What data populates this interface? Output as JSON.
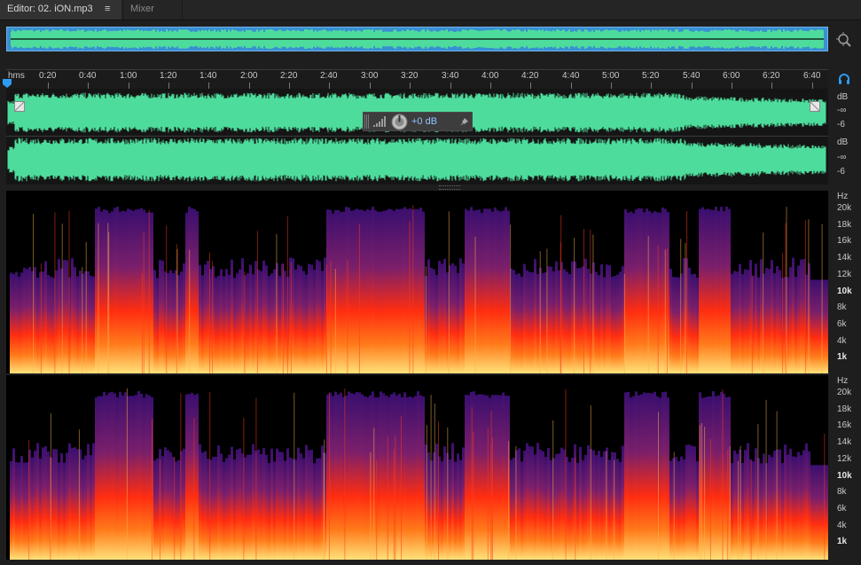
{
  "tabs": [
    {
      "label": "Editor: 02. iON.mp3",
      "active": true
    },
    {
      "label": "Mixer",
      "active": false
    }
  ],
  "icons": {
    "tab_menu": "hamburger-icon",
    "zoom": "zoom-navigator-icon",
    "monitor": "headphones-icon",
    "hud_meter": "level-meter-icon",
    "hud_knob": "volume-knob-icon",
    "hud_pin": "pin-icon"
  },
  "ruler": {
    "unit": "hms",
    "labels": [
      "0:20",
      "0:40",
      "1:00",
      "1:20",
      "1:40",
      "2:00",
      "2:20",
      "2:40",
      "3:00",
      "3:20",
      "3:40",
      "4:00",
      "4:20",
      "4:40",
      "5:00",
      "5:20",
      "5:40",
      "6:00",
      "6:20",
      "6:40"
    ]
  },
  "waveform": {
    "channels": [
      {
        "scale": [
          "dB",
          "-∞",
          "-6"
        ]
      },
      {
        "scale": [
          "dB",
          "-∞",
          "-6"
        ]
      }
    ]
  },
  "hud": {
    "value": "+0 dB"
  },
  "spectral": {
    "channels": [
      {
        "scale": [
          "Hz",
          "20k",
          "18k",
          "16k",
          "14k",
          "12k",
          "10k",
          "8k",
          "6k",
          "4k",
          "1k"
        ]
      },
      {
        "scale": [
          "Hz",
          "20k",
          "18k",
          "16k",
          "14k",
          "12k",
          "10k",
          "8k",
          "6k",
          "4k",
          "1k"
        ]
      }
    ]
  },
  "colors": {
    "waveform": "#4ddc9c",
    "overview_bg": "#3a8fd2",
    "accent": "#2f9bf0",
    "spectral_low": "#ffe27a",
    "spectral_mid": "#ff2d10",
    "spectral_high": "#3a0f6e"
  }
}
